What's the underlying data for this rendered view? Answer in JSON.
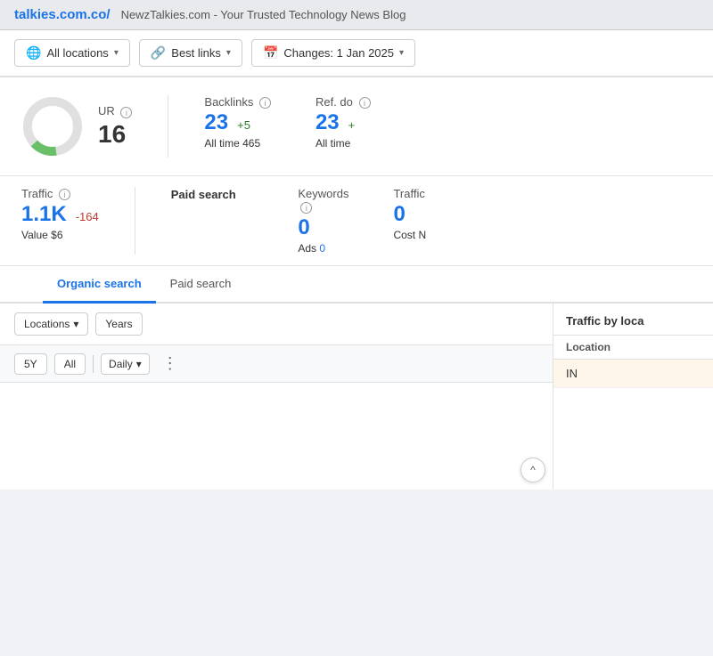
{
  "topbar": {
    "site": "talkies.com.co/",
    "page_title": "NewzTalkies.com - Your Trusted Technology News Blog"
  },
  "filters": {
    "location_label": "All locations",
    "links_label": "Best links",
    "changes_label": "Changes: 1 Jan 2025"
  },
  "ur": {
    "label": "UR",
    "value": "16"
  },
  "backlinks": {
    "label": "Backlinks",
    "value": "23",
    "delta": "+5",
    "sub_label": "All time",
    "sub_value": "465"
  },
  "ref_domains": {
    "label": "Ref. do",
    "value": "23",
    "delta": "+",
    "sub_label": "All time",
    "sub_value": ""
  },
  "traffic": {
    "label": "Traffic",
    "value": "1.1K",
    "delta": "-164",
    "sub_label": "Value",
    "sub_value": "$6"
  },
  "paid_search": {
    "section_label": "Paid search",
    "keywords": {
      "label": "Keywords",
      "value": "0",
      "sub_label": "Ads",
      "sub_value": "0"
    },
    "traffic_cost": {
      "label": "Traffic",
      "value": "0",
      "sub_label": "Cost",
      "sub_value": "N"
    }
  },
  "tabs": {
    "items": [
      {
        "label": "",
        "active": false
      },
      {
        "label": "Organic search",
        "active": true
      },
      {
        "label": "Paid search",
        "active": false
      }
    ]
  },
  "chart_controls": {
    "filters": [
      "Locations",
      "Years"
    ],
    "time_buttons": [
      "5Y",
      "All"
    ],
    "granularity": "Daily",
    "more_icon": "⋮"
  },
  "traffic_by_location": {
    "header": "Traffic by loca",
    "col_header": "Location",
    "rows": [
      {
        "country": "IN"
      }
    ]
  },
  "icons": {
    "globe": "🌐",
    "link": "🔗",
    "calendar": "📅",
    "chevron_down": "▾",
    "info": "i",
    "scroll_up": "^"
  }
}
